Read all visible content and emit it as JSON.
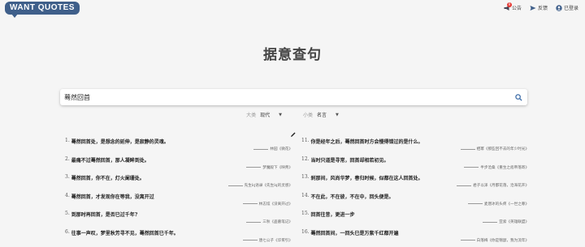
{
  "header": {
    "logo_text": "WANT QUOTES",
    "nav": [
      {
        "icon": "megaphone-icon",
        "label": "公告",
        "badge": "9"
      },
      {
        "icon": "send-icon",
        "label": "反馈"
      },
      {
        "icon": "user-icon",
        "label": "已登录"
      }
    ]
  },
  "page": {
    "title": "据意查句"
  },
  "search": {
    "value": "蓦然回首",
    "placeholder": ""
  },
  "filters": {
    "category": {
      "label": "大类",
      "value": "现代"
    },
    "subcategory": {
      "label": "小类",
      "value": "名言"
    }
  },
  "results": {
    "left": [
      {
        "num": "1.",
        "text": "蓦然回首处，是想念的延伸，是寂静的灵魂。",
        "source": "林园《微花》"
      },
      {
        "num": "2.",
        "text": "最痛不过蓦然回首，那人凝眸到处。",
        "source": "梦魔殿下《映青》"
      },
      {
        "num": "3.",
        "text": "蓦然回首，你不在，灯火阑珊处。",
        "source": "先生lq语录《先生lq的灵感》"
      },
      {
        "num": "4.",
        "text": "蓦然回首，才发现你在等我，没离开过",
        "source": "林志炫《没离开过》"
      },
      {
        "num": "5.",
        "text": "到那时再回首，是否已过千年?",
        "source": "三秋《盗墓笔记》"
      },
      {
        "num": "6.",
        "text": "往事一声叹，梦里秋芳寻不见，蓦然回首已千年。",
        "source": "唐七公子《华胥引》"
      }
    ],
    "right": [
      {
        "num": "11.",
        "text": "你是经年之后，蓦然回首时方会慢得错过的是什么。",
        "source": "栖幂《那些回不去的年少时光》"
      },
      {
        "num": "12.",
        "text": "当时只道是寻常，回首却相若初见。",
        "source": "半步沧桑《重生之痞帝落寄》"
      },
      {
        "num": "13.",
        "text": "刹那间，风尚华梦，春归时候，似都在这人回首处。",
        "source": "君子以泽《月都花落，沧海花开》"
      },
      {
        "num": "14.",
        "text": "不在此，不在彼，不在中，回头便是。",
        "source": "麦唐冰的头疼《一世之尊》"
      },
      {
        "num": "15.",
        "text": "回首往昔，更进一步",
        "source": "亚索《英雄联盟》"
      },
      {
        "num": "16.",
        "text": "蓦然回首间，一回头已是万紫千红都开遍",
        "source": "白落梅《你是锦瑟，我为流年》"
      }
    ]
  },
  "colors": {
    "logo_bg": "#3f5f8a",
    "badge": "#e53935",
    "search_icon": "#3f6ea8"
  }
}
